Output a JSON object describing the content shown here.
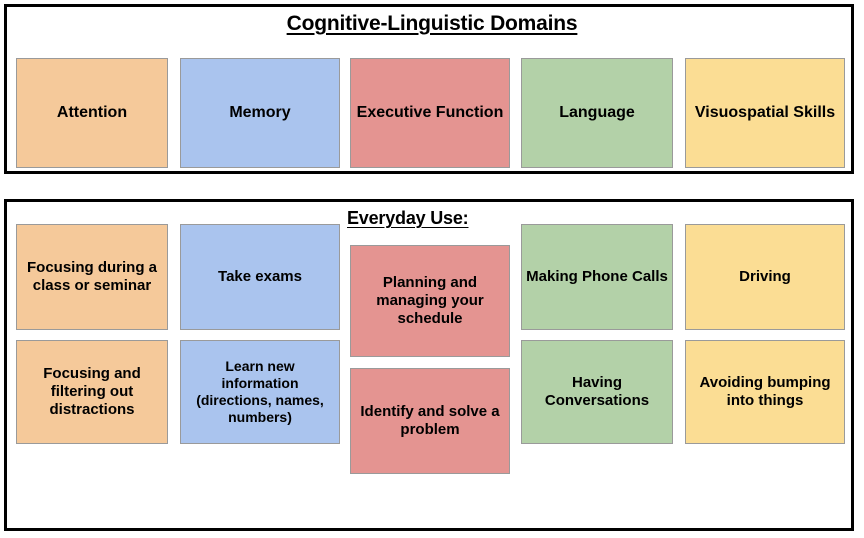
{
  "palette": {
    "orange": "#f5c99a",
    "blue": "#aac4ee",
    "red": "#e49491",
    "green": "#b3d1a8",
    "yellow": "#fbdd94",
    "frame": "#000000",
    "box_border": "#9a9a9a",
    "text": "#000000",
    "background": "#ffffff"
  },
  "domains_panel": {
    "title": "Cognitive-Linguistic Domains",
    "boxes": [
      {
        "label": "Attention",
        "color": "orange"
      },
      {
        "label": "Memory",
        "color": "blue"
      },
      {
        "label": "Executive Function",
        "color": "red"
      },
      {
        "label": "Language",
        "color": "green"
      },
      {
        "label": "Visuospatial Skills",
        "color": "yellow"
      }
    ]
  },
  "everyday_panel": {
    "title": "Everyday Use:",
    "columns": [
      {
        "domain": "Attention",
        "color": "orange",
        "items": [
          "Focusing during a class or seminar",
          "Focusing and filtering out distractions"
        ]
      },
      {
        "domain": "Memory",
        "color": "blue",
        "items": [
          "Take exams",
          "Learn new information (directions, names, numbers)"
        ]
      },
      {
        "domain": "Executive Function",
        "color": "red",
        "items": [
          "Planning and managing your schedule",
          "Identify and solve a problem"
        ]
      },
      {
        "domain": "Language",
        "color": "green",
        "items": [
          "Making Phone Calls",
          "Having Conversations"
        ]
      },
      {
        "domain": "Visuospatial Skills",
        "color": "yellow",
        "items": [
          "Driving",
          "Avoiding bumping into things"
        ]
      }
    ]
  }
}
